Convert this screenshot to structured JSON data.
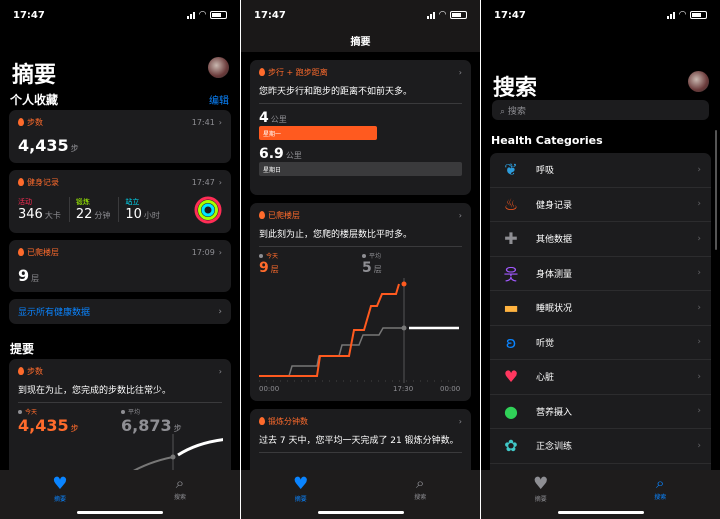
{
  "status": {
    "time": "17:47"
  },
  "panel1": {
    "title": "摘要",
    "favorites_label": "个人收藏",
    "edit_label": "编辑",
    "steps": {
      "title": "步数",
      "time": "17:41",
      "value": "4,435",
      "unit": "步"
    },
    "activity": {
      "title": "健身记录",
      "time": "17:47",
      "move": {
        "label": "活动",
        "value": "346",
        "unit": "大卡",
        "color": "#ff2d55"
      },
      "exercise": {
        "label": "锻炼",
        "value": "22",
        "unit": "分钟",
        "color": "#a6ff00"
      },
      "stand": {
        "label": "站立",
        "value": "10",
        "unit": "小时",
        "color": "#00e5ff"
      }
    },
    "floors": {
      "title": "已爬楼层",
      "time": "17:09",
      "value": "9",
      "unit": "层"
    },
    "show_all": "显示所有健康数据",
    "highlights_label": "提要",
    "highlight": {
      "title": "步数",
      "desc": "到现在为止，您完成的步数比往常少。",
      "today_label": "今天",
      "today_value": "4,435",
      "avg_label": "平均",
      "avg_value": "6,873",
      "unit": "步"
    }
  },
  "panel2": {
    "nav_title": "摘要",
    "distance": {
      "title": "步行 + 跑步距离",
      "desc": "您昨天步行和跑步的距离不如前天多。",
      "v1": "4",
      "u1": "公里",
      "d1": "星期一",
      "v2": "6.9",
      "u2": "公里",
      "d2": "星期日",
      "ratio1": 0.58,
      "ratio2": 1.0
    },
    "floors": {
      "title": "已爬楼层",
      "desc": "到此刻为止，您爬的楼层数比平时多。",
      "today_label": "今天",
      "today_value": "9",
      "avg_label": "平均",
      "avg_value": "5",
      "unit": "层",
      "x_labels": [
        "00:00",
        "17:30",
        "00:00"
      ]
    },
    "exercise": {
      "title": "锻炼分钟数",
      "desc": "过去 7 天中，您平均一天完成了 21 锻炼分钟数。"
    }
  },
  "panel3": {
    "title": "搜索",
    "search_placeholder": "搜索",
    "categories_label": "Health Categories",
    "categories": [
      {
        "name": "呼吸",
        "icon": "lungs-icon",
        "color": "#2d9cdb"
      },
      {
        "name": "健身记录",
        "icon": "flame-icon",
        "color": "#ff5a1f"
      },
      {
        "name": "其他数据",
        "icon": "plus-icon",
        "color": "#8e8e93"
      },
      {
        "name": "身体测量",
        "icon": "body-icon",
        "color": "#a259ff"
      },
      {
        "name": "睡眠状况",
        "icon": "bed-icon",
        "color": "#ffb340"
      },
      {
        "name": "听觉",
        "icon": "ear-icon",
        "color": "#0a84ff"
      },
      {
        "name": "心脏",
        "icon": "heart-icon",
        "color": "#ff375f"
      },
      {
        "name": "营养摄入",
        "icon": "apple-icon",
        "color": "#30d158"
      },
      {
        "name": "正念训练",
        "icon": "mindfulness-icon",
        "color": "#40c8c8"
      }
    ]
  },
  "tabs": [
    {
      "label": "摘要"
    },
    {
      "label": "搜索"
    }
  ]
}
